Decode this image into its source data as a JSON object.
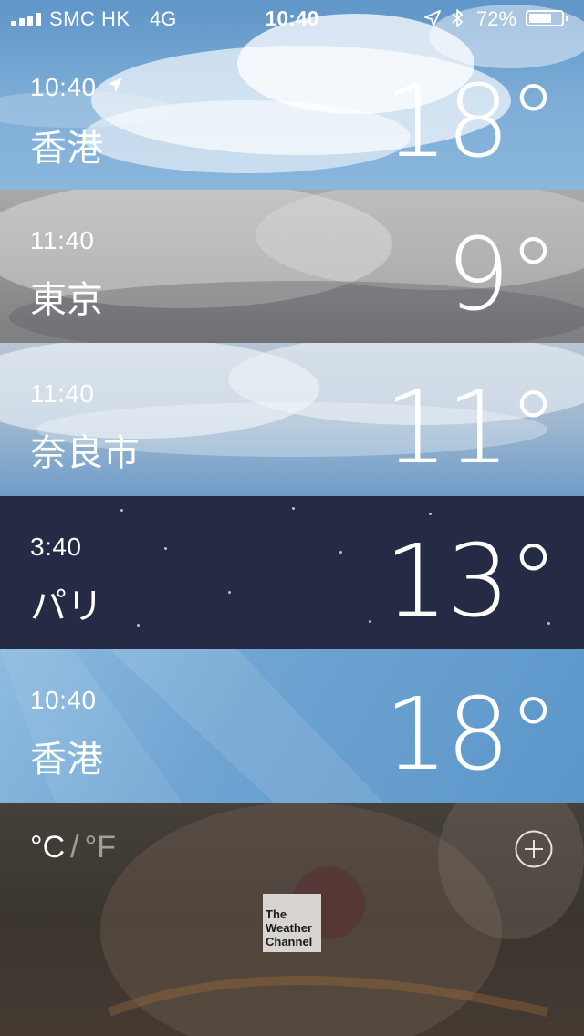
{
  "status_bar": {
    "carrier": "SMC HK",
    "network": "4G",
    "time": "10:40",
    "battery_percent": "72%",
    "battery_level": 0.72,
    "signal_bars": 4
  },
  "cities": [
    {
      "time": "10:40",
      "name": "香港",
      "temp": "18°",
      "current_location": true,
      "condition": "partly-cloudy-day"
    },
    {
      "time": "11:40",
      "name": "東京",
      "temp": "9°",
      "current_location": false,
      "condition": "cloudy"
    },
    {
      "time": "11:40",
      "name": "奈良市",
      "temp": "11°",
      "current_location": false,
      "condition": "partly-cloudy-day"
    },
    {
      "time": "3:40",
      "name": "パリ",
      "temp": "13°",
      "current_location": false,
      "condition": "clear-night"
    },
    {
      "time": "10:40",
      "name": "香港",
      "temp": "18°",
      "current_location": false,
      "condition": "sunny"
    }
  ],
  "footer": {
    "unit_celsius": "°C",
    "unit_separator": "/",
    "unit_fahrenheit": "°F",
    "add_icon": "plus-circle-icon",
    "logo_lines": [
      "The",
      "Weather",
      "Channel"
    ]
  },
  "colors": {
    "text": "#ffffff",
    "night_bg": "#252b45"
  }
}
